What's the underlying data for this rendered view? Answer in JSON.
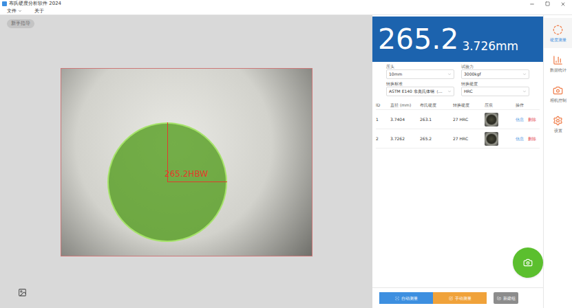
{
  "window": {
    "title": "布氏硬度分析软件 2024"
  },
  "menu": [
    "文件",
    "关于"
  ],
  "guide_button": "新手指导",
  "overlay": {
    "label": "265.2HBW"
  },
  "result": {
    "hardness": "265.2",
    "diameter": "3.726mm"
  },
  "fields": [
    {
      "label": "压头",
      "value": "10mm"
    },
    {
      "label": "试验力",
      "value": "3000kgf"
    },
    {
      "label": "转换标准",
      "value": "ASTM E140 非奥氏体钢（..."
    },
    {
      "label": "转换硬度",
      "value": "HRC"
    }
  ],
  "table": {
    "columns": [
      "ID",
      "直径 (mm)",
      "布氏硬度",
      "转换硬度",
      "压痕",
      "操作"
    ],
    "rows": [
      {
        "id": "1",
        "diameter": "3.7404",
        "hardness": "263.1",
        "converted": "27 HRC",
        "actions": [
          "信息",
          "删除"
        ]
      },
      {
        "id": "2",
        "diameter": "3.7262",
        "hardness": "265.2",
        "converted": "27 HRC",
        "actions": [
          "信息",
          "删除"
        ]
      }
    ]
  },
  "buttons": [
    {
      "label": "自动测量",
      "color": "#3d8fe0"
    },
    {
      "label": "手动测量",
      "color": "#f0a23a"
    },
    {
      "label": "新建组",
      "color": "#8c8c8c"
    }
  ],
  "sidebar": {
    "items": [
      {
        "label": "硬度测量",
        "selected": true
      },
      {
        "label": "数据统计",
        "selected": false
      },
      {
        "label": "相机控制",
        "selected": false
      },
      {
        "label": "设置",
        "selected": false
      }
    ]
  }
}
